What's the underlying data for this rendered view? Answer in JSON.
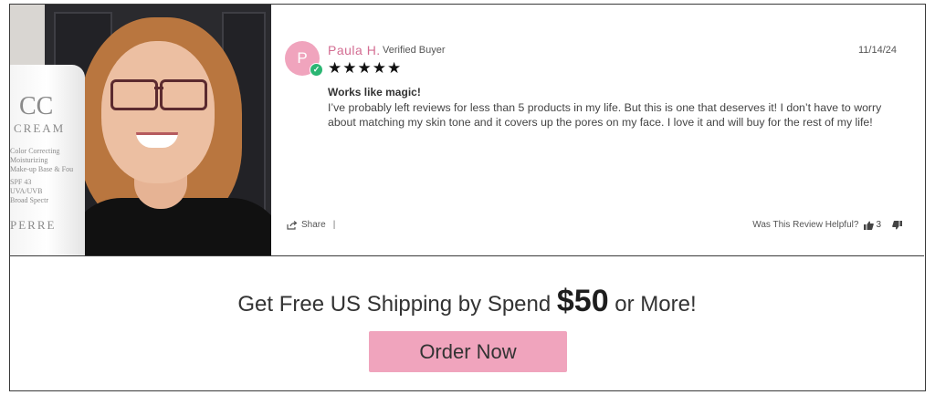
{
  "review": {
    "avatar_initial": "P",
    "reviewer_name": "Paula H.",
    "verified_label": "Verified Buyer",
    "date": "11/14/24",
    "rating": 5,
    "stars": "★★★★★",
    "title": "Works like magic!",
    "body": "I’ve probably left reviews for less than 5 products in my life. But this is one that deserves it! I don’t have to worry about matching my skin tone and it covers up the pores on my face. I love it and will buy for the rest of my life!",
    "share_label": "Share",
    "helpful_label": "Was This Review Helpful?",
    "thumbs_up_count": "3",
    "photo": {
      "tube_lines": [
        "CC",
        "CREAM",
        "Color Correcting",
        "Moisturizing",
        "Make-up Base & Fou",
        "SPF 43",
        "UVA/UVB",
        "Broad Spectr",
        "PERRE"
      ]
    }
  },
  "promo": {
    "text_before": "Get Free US Shipping by Spend ",
    "amount": "$50",
    "text_after": " or More!",
    "button_label": "Order Now"
  },
  "colors": {
    "accent_pink": "#f0a4bd",
    "name_pink": "#d36d92",
    "verified_green": "#2bb673"
  },
  "icons": [
    "share-icon",
    "thumbs-up-icon",
    "thumbs-down-icon",
    "verified-check-icon",
    "star-icon"
  ]
}
